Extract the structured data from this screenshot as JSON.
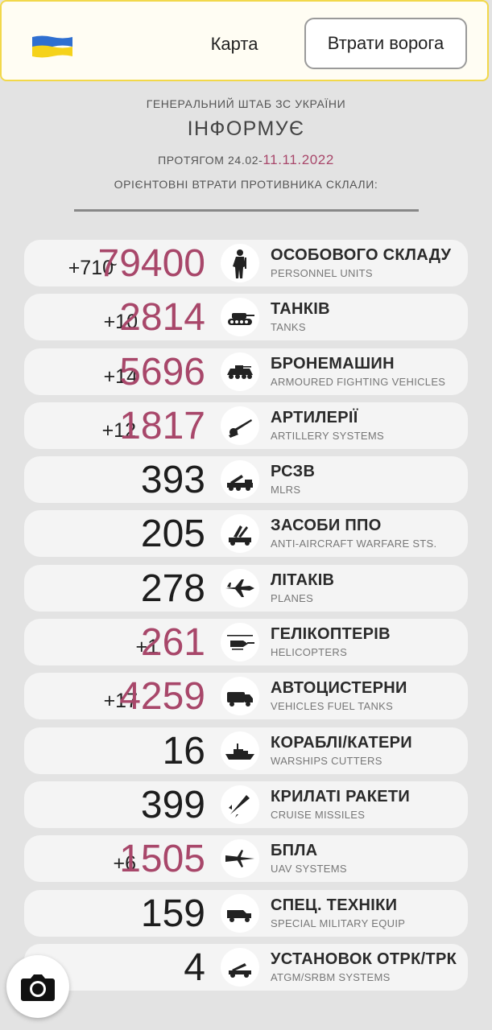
{
  "nav": {
    "map_label": "Карта",
    "losses_label": "Втрати ворога",
    "flag_colors": [
      "#2f6fd0",
      "#f5d21a"
    ]
  },
  "header": {
    "line1": "ГЕНЕРАЛЬНИЙ ШТАБ ЗС УКРАЇНИ",
    "line2": "ІНФОРМУЄ",
    "period_prefix": "ПРОТЯГОМ 24.02-",
    "period_date": "11.11.2022",
    "line4": "ОРІЄНТОВНІ ВТРАТИ ПРОТИВНИКА СКЛАЛИ:"
  },
  "rows": [
    {
      "delta": "+710",
      "approx": "~",
      "value": "79400",
      "title_ua": "ОСОБОВОГО СКЛАДУ",
      "title_en": "PERSONNEL UNITS",
      "icon": "soldier-icon"
    },
    {
      "delta": "+10",
      "value": "2814",
      "title_ua": "ТАНКІВ",
      "title_en": "TANKS",
      "icon": "tank-icon"
    },
    {
      "delta": "+14",
      "value": "5696",
      "title_ua": "БРОНЕМАШИН",
      "title_en": "ARMOURED FIGHTING VEHICLES",
      "icon": "armored-vehicle-icon"
    },
    {
      "delta": "+12",
      "value": "1817",
      "title_ua": "АРТИЛЕРІЇ",
      "title_en": "ARTILLERY SYSTEMS",
      "icon": "artillery-icon"
    },
    {
      "delta": "",
      "value": "393",
      "title_ua": "РСЗВ",
      "title_en": "MLRS",
      "icon": "mlrs-icon"
    },
    {
      "delta": "",
      "value": "205",
      "title_ua": "ЗАСОБИ ППО",
      "title_en": "ANTI-AIRCRAFT WARFARE STS.",
      "icon": "anti-aircraft-icon"
    },
    {
      "delta": "",
      "value": "278",
      "title_ua": "ЛІТАКІВ",
      "title_en": "PLANES",
      "icon": "plane-icon"
    },
    {
      "delta": "+1",
      "value": "261",
      "title_ua": "ГЕЛІКОПТЕРІВ",
      "title_en": "HELICOPTERS",
      "icon": "helicopter-icon"
    },
    {
      "delta": "+17",
      "value": "4259",
      "title_ua": "АВТОЦИСТЕРНИ",
      "title_en": "VEHICLES FUEL TANKS",
      "icon": "fuel-truck-icon"
    },
    {
      "delta": "",
      "value": "16",
      "title_ua": "КОРАБЛІ/КАТЕРИ",
      "title_en": "WARSHIPS CUTTERS",
      "icon": "warship-icon"
    },
    {
      "delta": "",
      "value": "399",
      "title_ua": "КРИЛАТІ РАКЕТИ",
      "title_en": "CRUISE MISSILES",
      "icon": "missile-icon"
    },
    {
      "delta": "+6",
      "value": "1505",
      "title_ua": "БПЛА",
      "title_en": "UAV SYSTEMS",
      "icon": "drone-icon"
    },
    {
      "delta": "",
      "value": "159",
      "title_ua": "СПЕЦ. ТЕХНІКИ",
      "title_en": "SPECIAL MILITARY EQUIP",
      "icon": "special-vehicle-icon"
    },
    {
      "delta": "",
      "value": "4",
      "title_ua": "УСТАНОВОК ОТРК/ТРК",
      "title_en": "ATGM/SRBM SYSTEMS",
      "icon": "srbm-launcher-icon"
    }
  ],
  "colors": {
    "accent": "#a8476a",
    "background": "#e3e3e3",
    "card": "#f4f4f4",
    "topbar_border": "#f2d84a"
  }
}
